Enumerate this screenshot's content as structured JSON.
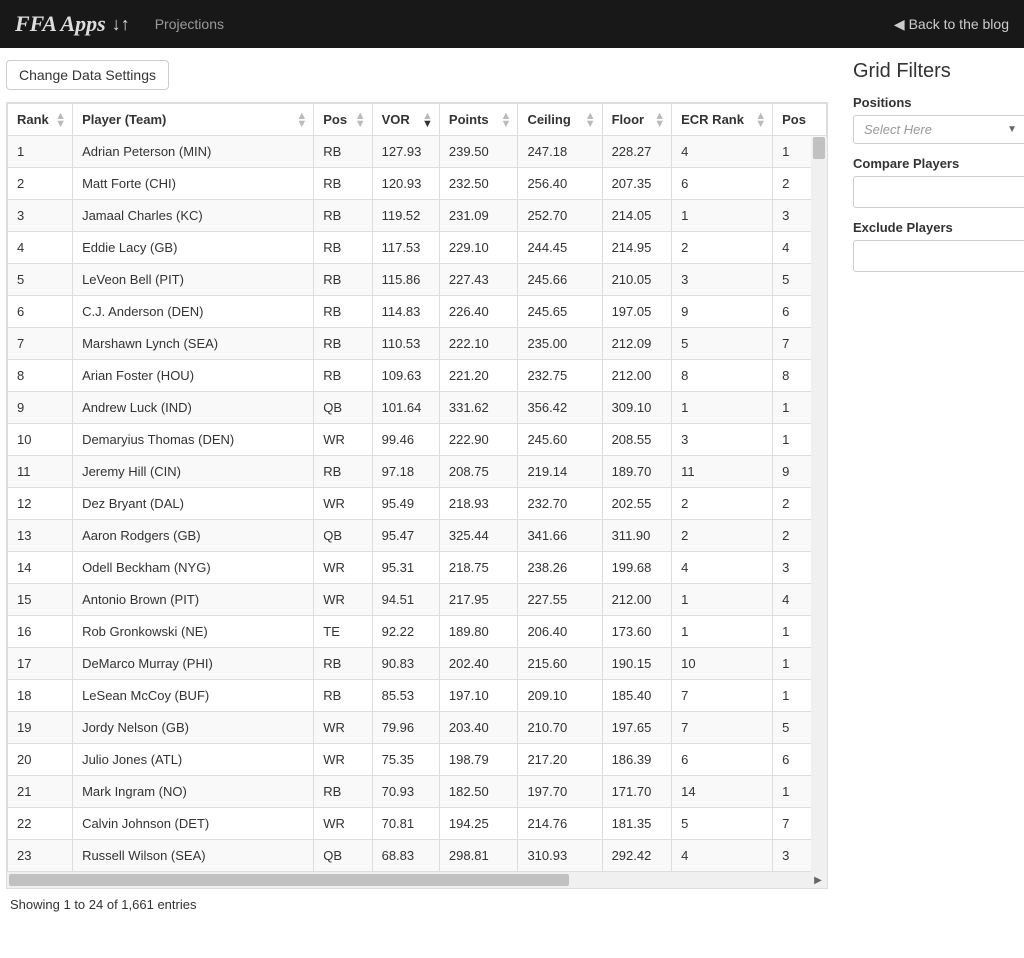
{
  "navbar": {
    "brand": "FFA Apps",
    "link": "Projections",
    "back": "Back to the blog"
  },
  "toolbar": {
    "change_settings": "Change Data Settings"
  },
  "table": {
    "columns": [
      "Rank",
      "Player (Team)",
      "Pos",
      "VOR",
      "Points",
      "Ceiling",
      "Floor",
      "ECR Rank",
      "Pos"
    ],
    "rows": [
      {
        "rank": "1",
        "player": "Adrian Peterson (MIN)",
        "pos": "RB",
        "vor": "127.93",
        "points": "239.50",
        "ceiling": "247.18",
        "floor": "228.27",
        "ecr": "4",
        "posrank": "1"
      },
      {
        "rank": "2",
        "player": "Matt Forte (CHI)",
        "pos": "RB",
        "vor": "120.93",
        "points": "232.50",
        "ceiling": "256.40",
        "floor": "207.35",
        "ecr": "6",
        "posrank": "2"
      },
      {
        "rank": "3",
        "player": "Jamaal Charles (KC)",
        "pos": "RB",
        "vor": "119.52",
        "points": "231.09",
        "ceiling": "252.70",
        "floor": "214.05",
        "ecr": "1",
        "posrank": "3"
      },
      {
        "rank": "4",
        "player": "Eddie Lacy (GB)",
        "pos": "RB",
        "vor": "117.53",
        "points": "229.10",
        "ceiling": "244.45",
        "floor": "214.95",
        "ecr": "2",
        "posrank": "4"
      },
      {
        "rank": "5",
        "player": "LeVeon Bell (PIT)",
        "pos": "RB",
        "vor": "115.86",
        "points": "227.43",
        "ceiling": "245.66",
        "floor": "210.05",
        "ecr": "3",
        "posrank": "5"
      },
      {
        "rank": "6",
        "player": "C.J. Anderson (DEN)",
        "pos": "RB",
        "vor": "114.83",
        "points": "226.40",
        "ceiling": "245.65",
        "floor": "197.05",
        "ecr": "9",
        "posrank": "6"
      },
      {
        "rank": "7",
        "player": "Marshawn Lynch (SEA)",
        "pos": "RB",
        "vor": "110.53",
        "points": "222.10",
        "ceiling": "235.00",
        "floor": "212.09",
        "ecr": "5",
        "posrank": "7"
      },
      {
        "rank": "8",
        "player": "Arian Foster (HOU)",
        "pos": "RB",
        "vor": "109.63",
        "points": "221.20",
        "ceiling": "232.75",
        "floor": "212.00",
        "ecr": "8",
        "posrank": "8"
      },
      {
        "rank": "9",
        "player": "Andrew Luck (IND)",
        "pos": "QB",
        "vor": "101.64",
        "points": "331.62",
        "ceiling": "356.42",
        "floor": "309.10",
        "ecr": "1",
        "posrank": "1"
      },
      {
        "rank": "10",
        "player": "Demaryius Thomas (DEN)",
        "pos": "WR",
        "vor": "99.46",
        "points": "222.90",
        "ceiling": "245.60",
        "floor": "208.55",
        "ecr": "3",
        "posrank": "1"
      },
      {
        "rank": "11",
        "player": "Jeremy Hill (CIN)",
        "pos": "RB",
        "vor": "97.18",
        "points": "208.75",
        "ceiling": "219.14",
        "floor": "189.70",
        "ecr": "11",
        "posrank": "9"
      },
      {
        "rank": "12",
        "player": "Dez Bryant (DAL)",
        "pos": "WR",
        "vor": "95.49",
        "points": "218.93",
        "ceiling": "232.70",
        "floor": "202.55",
        "ecr": "2",
        "posrank": "2"
      },
      {
        "rank": "13",
        "player": "Aaron Rodgers (GB)",
        "pos": "QB",
        "vor": "95.47",
        "points": "325.44",
        "ceiling": "341.66",
        "floor": "311.90",
        "ecr": "2",
        "posrank": "2"
      },
      {
        "rank": "14",
        "player": "Odell Beckham (NYG)",
        "pos": "WR",
        "vor": "95.31",
        "points": "218.75",
        "ceiling": "238.26",
        "floor": "199.68",
        "ecr": "4",
        "posrank": "3"
      },
      {
        "rank": "15",
        "player": "Antonio Brown (PIT)",
        "pos": "WR",
        "vor": "94.51",
        "points": "217.95",
        "ceiling": "227.55",
        "floor": "212.00",
        "ecr": "1",
        "posrank": "4"
      },
      {
        "rank": "16",
        "player": "Rob Gronkowski (NE)",
        "pos": "TE",
        "vor": "92.22",
        "points": "189.80",
        "ceiling": "206.40",
        "floor": "173.60",
        "ecr": "1",
        "posrank": "1"
      },
      {
        "rank": "17",
        "player": "DeMarco Murray (PHI)",
        "pos": "RB",
        "vor": "90.83",
        "points": "202.40",
        "ceiling": "215.60",
        "floor": "190.15",
        "ecr": "10",
        "posrank": "1"
      },
      {
        "rank": "18",
        "player": "LeSean McCoy (BUF)",
        "pos": "RB",
        "vor": "85.53",
        "points": "197.10",
        "ceiling": "209.10",
        "floor": "185.40",
        "ecr": "7",
        "posrank": "1"
      },
      {
        "rank": "19",
        "player": "Jordy Nelson (GB)",
        "pos": "WR",
        "vor": "79.96",
        "points": "203.40",
        "ceiling": "210.70",
        "floor": "197.65",
        "ecr": "7",
        "posrank": "5"
      },
      {
        "rank": "20",
        "player": "Julio Jones (ATL)",
        "pos": "WR",
        "vor": "75.35",
        "points": "198.79",
        "ceiling": "217.20",
        "floor": "186.39",
        "ecr": "6",
        "posrank": "6"
      },
      {
        "rank": "21",
        "player": "Mark Ingram (NO)",
        "pos": "RB",
        "vor": "70.93",
        "points": "182.50",
        "ceiling": "197.70",
        "floor": "171.70",
        "ecr": "14",
        "posrank": "1"
      },
      {
        "rank": "22",
        "player": "Calvin Johnson (DET)",
        "pos": "WR",
        "vor": "70.81",
        "points": "194.25",
        "ceiling": "214.76",
        "floor": "181.35",
        "ecr": "5",
        "posrank": "7"
      },
      {
        "rank": "23",
        "player": "Russell Wilson (SEA)",
        "pos": "QB",
        "vor": "68.83",
        "points": "298.81",
        "ceiling": "310.93",
        "floor": "292.42",
        "ecr": "4",
        "posrank": "3"
      }
    ],
    "info": "Showing 1 to 24 of 1,661 entries"
  },
  "filters": {
    "title": "Grid Filters",
    "positions_label": "Positions",
    "positions_placeholder": "Select Here",
    "compare_label": "Compare Players",
    "exclude_label": "Exclude Players"
  }
}
